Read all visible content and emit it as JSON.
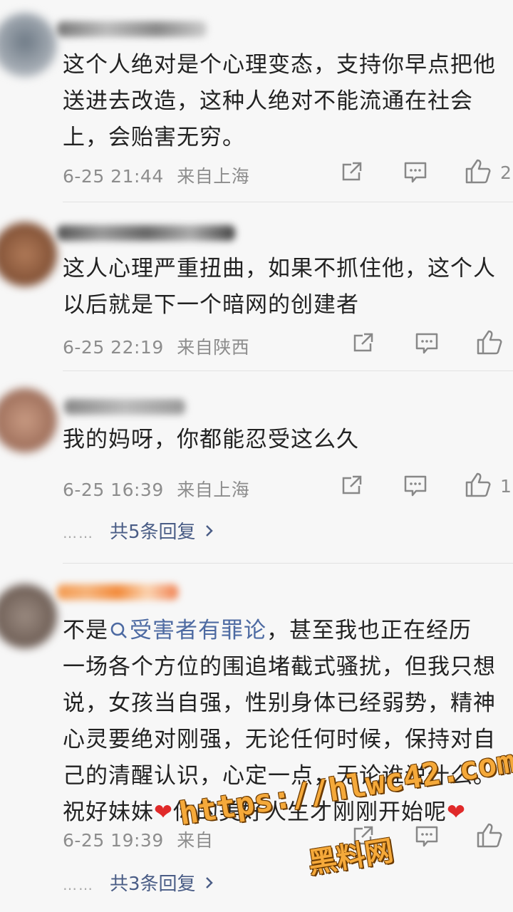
{
  "comments": [
    {
      "text": "这个人绝对是个心理变态，支持你早点把他\n送进去改造，这种人绝对不能流通在社会\n上，会贻害无穷。",
      "time": "6-25 21:44",
      "location": "来自上海",
      "likes": "2"
    },
    {
      "text": "这人心理严重扭曲，如果不抓住他，这个人\n以后就是下一个暗网的创建者",
      "time": "6-25 22:19",
      "location": "来自陕西",
      "likes": ""
    },
    {
      "text": "我的妈呀，你都能忍受这么久",
      "time": "6-25 16:39",
      "location": "来自上海",
      "likes": "1",
      "replies": "共5条回复"
    },
    {
      "text_prefix": "不是",
      "topic": "受害者有罪论",
      "text_suffix": "，甚至我也正在经历\n一场各个方位的围追堵截式骚扰，但我只想\n说，女孩当自强，性别身体已经弱势，精神\n心灵要绝对刚强，无论任何时候，保持对自\n己的清醒认识，心定一点，无论谁说什么。\n祝好妹妹",
      "heart": "❤",
      "text_tail": "你的美好人生才刚刚开始呢",
      "time": "6-25 19:39",
      "location": "来自",
      "likes": "",
      "replies": "共3条回复"
    }
  ],
  "reply_dots": "……",
  "watermark": {
    "url": "https://hlwc42.com",
    "name": "黑料网"
  },
  "colors": {
    "link": "#4a5d86",
    "heart": "#e02a2a",
    "meta": "#8d8d8d"
  }
}
